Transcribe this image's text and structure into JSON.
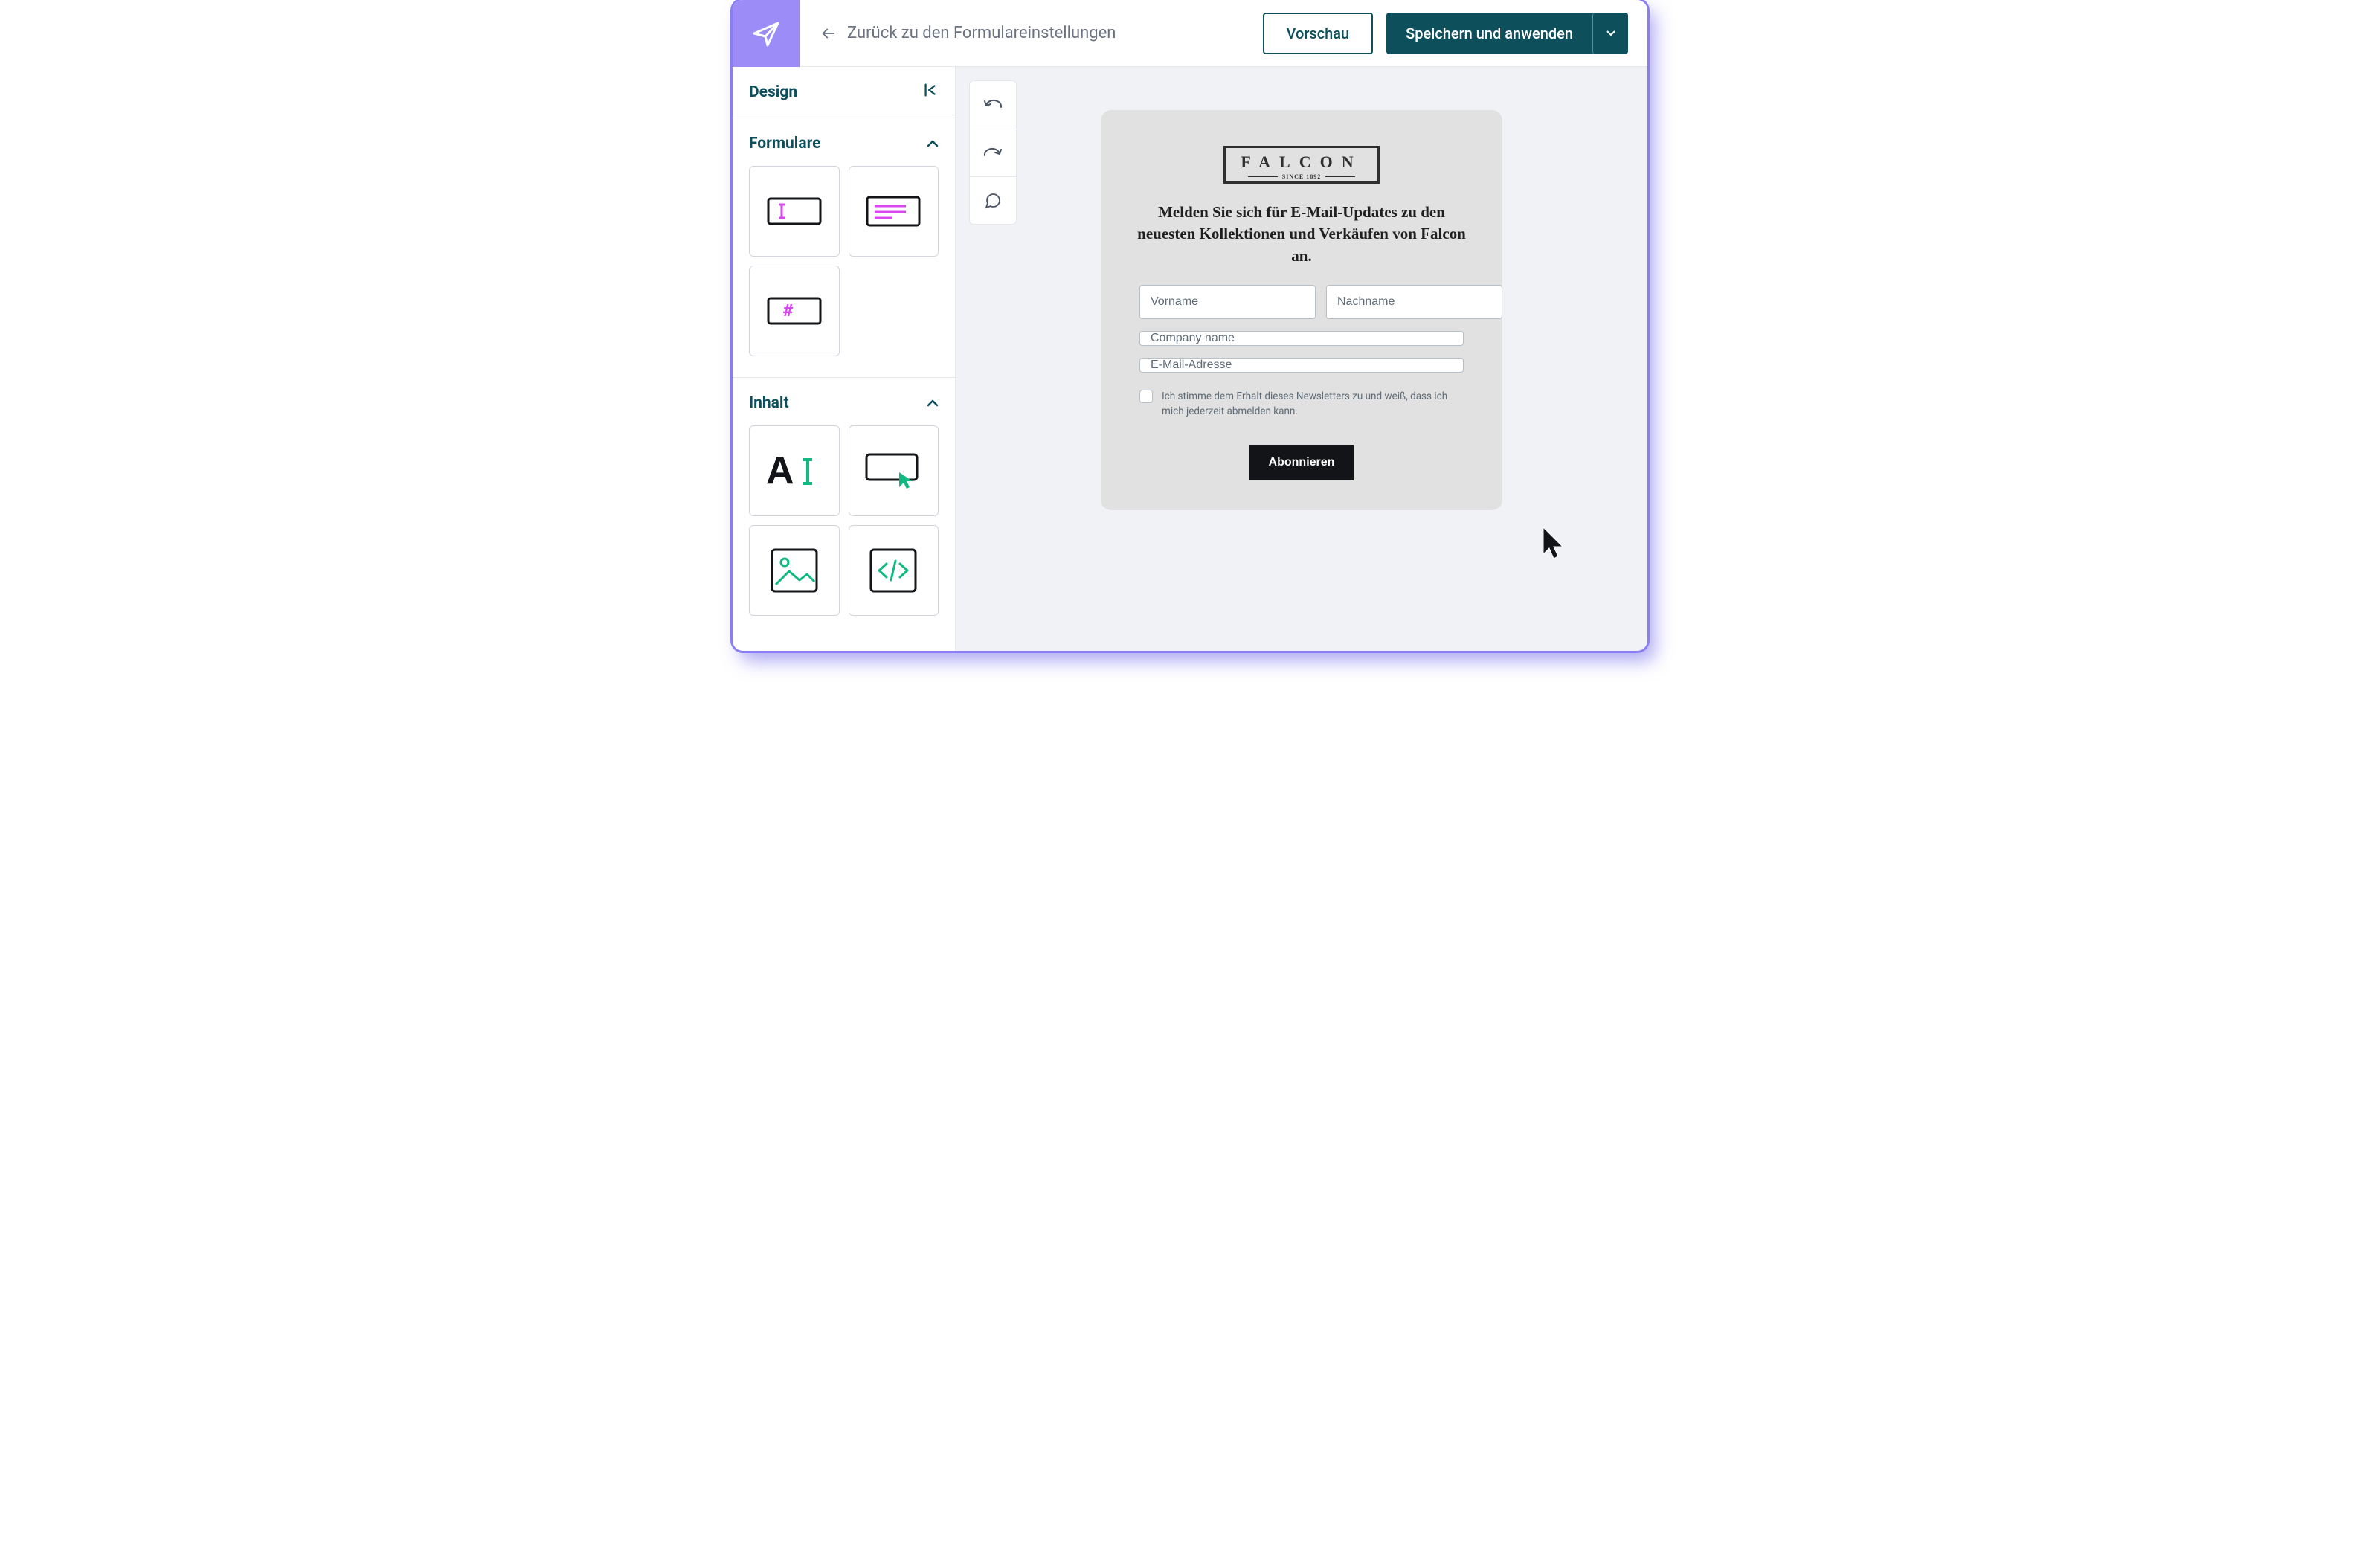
{
  "topbar": {
    "back_label": "Zurück zu den Formulareinstellungen",
    "preview_label": "Vorschau",
    "save_label": "Speichern und anwenden"
  },
  "sidebar": {
    "design_label": "Design",
    "sections": {
      "forms": {
        "label": "Formulare"
      },
      "content": {
        "label": "Inhalt"
      }
    }
  },
  "preview": {
    "brand_name": "FALCON",
    "brand_since": "SINCE 1892",
    "heading": "Melden Sie sich für E-Mail-Updates zu den neuesten Kollektionen und Verkäufen von Falcon an.",
    "fields": {
      "firstname_placeholder": "Vorname",
      "lastname_placeholder": "Nachname",
      "company_placeholder": "Company name",
      "email_placeholder": "E-Mail-Adresse"
    },
    "consent_text": "Ich stimme dem Erhalt dieses Newsletters zu und weiß, dass ich mich jederzeit abmelden kann.",
    "subscribe_label": "Abonnieren"
  }
}
